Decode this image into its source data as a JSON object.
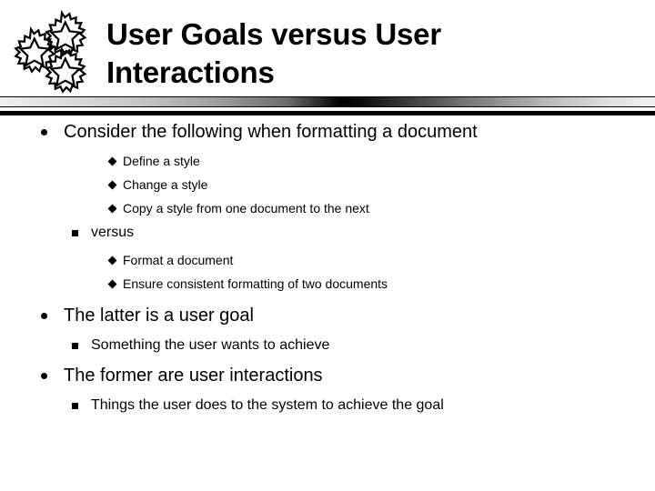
{
  "slide": {
    "title_line1": "User Goals versus User",
    "title_line2": "Interactions",
    "title_full": "User Goals versus User\nInteractions",
    "icon": "three-gears-icon",
    "colors": {
      "background": "#ffffff",
      "text": "#000000",
      "divider_dark": "#000000",
      "divider_light": "#f2f2f2"
    },
    "bullets": [
      {
        "level": 1,
        "marker": "round-bullet",
        "text": "Consider the following when formatting a document"
      },
      {
        "level": 3,
        "marker": "diamond-bullet",
        "text": "Define a style"
      },
      {
        "level": 3,
        "marker": "diamond-bullet",
        "text": "Change a style"
      },
      {
        "level": 3,
        "marker": "diamond-bullet",
        "text": "Copy a style from one document to the next"
      },
      {
        "level": 2,
        "marker": "square-bullet",
        "text": "versus"
      },
      {
        "level": 3,
        "marker": "diamond-bullet",
        "text": "Format a document"
      },
      {
        "level": 3,
        "marker": "diamond-bullet",
        "text": "Ensure consistent formatting of two documents"
      },
      {
        "level": 1,
        "marker": "round-bullet",
        "text": "The latter is a user goal"
      },
      {
        "level": 2,
        "marker": "square-bullet",
        "text": "Something the user wants to achieve"
      },
      {
        "level": 1,
        "marker": "round-bullet",
        "text": "The former are user interactions"
      },
      {
        "level": 2,
        "marker": "square-bullet",
        "text": "Things the user does to the system to achieve the goal"
      }
    ]
  }
}
